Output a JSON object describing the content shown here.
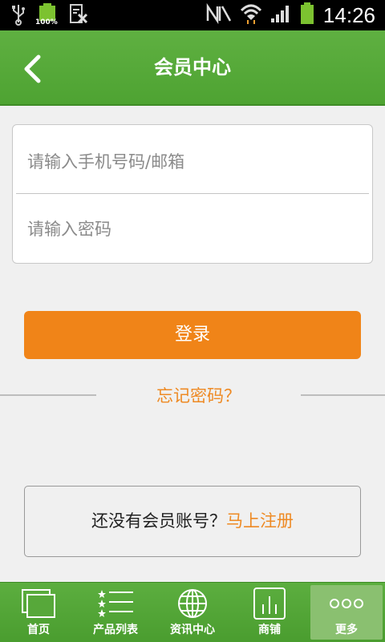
{
  "status_bar": {
    "time": "14:26",
    "battery_small_label": "100%"
  },
  "header": {
    "title": "会员中心"
  },
  "login_form": {
    "account_placeholder": "请输入手机号码/邮箱",
    "password_placeholder": "请输入密码",
    "submit_label": "登录",
    "forgot_label": "忘记密码？"
  },
  "register": {
    "prompt": "还没有会员账号？",
    "link_label": "马上注册"
  },
  "tabs": [
    {
      "label": "首页",
      "icon": "home-windows-icon"
    },
    {
      "label": "产品列表",
      "icon": "list-icon"
    },
    {
      "label": "资讯中心",
      "icon": "globe-icon"
    },
    {
      "label": "商铺",
      "icon": "chart-icon"
    },
    {
      "label": "更多",
      "icon": "more-dots-icon",
      "active": true
    }
  ],
  "colors": {
    "brand_green": "#4ea332",
    "accent_orange": "#f08418"
  }
}
